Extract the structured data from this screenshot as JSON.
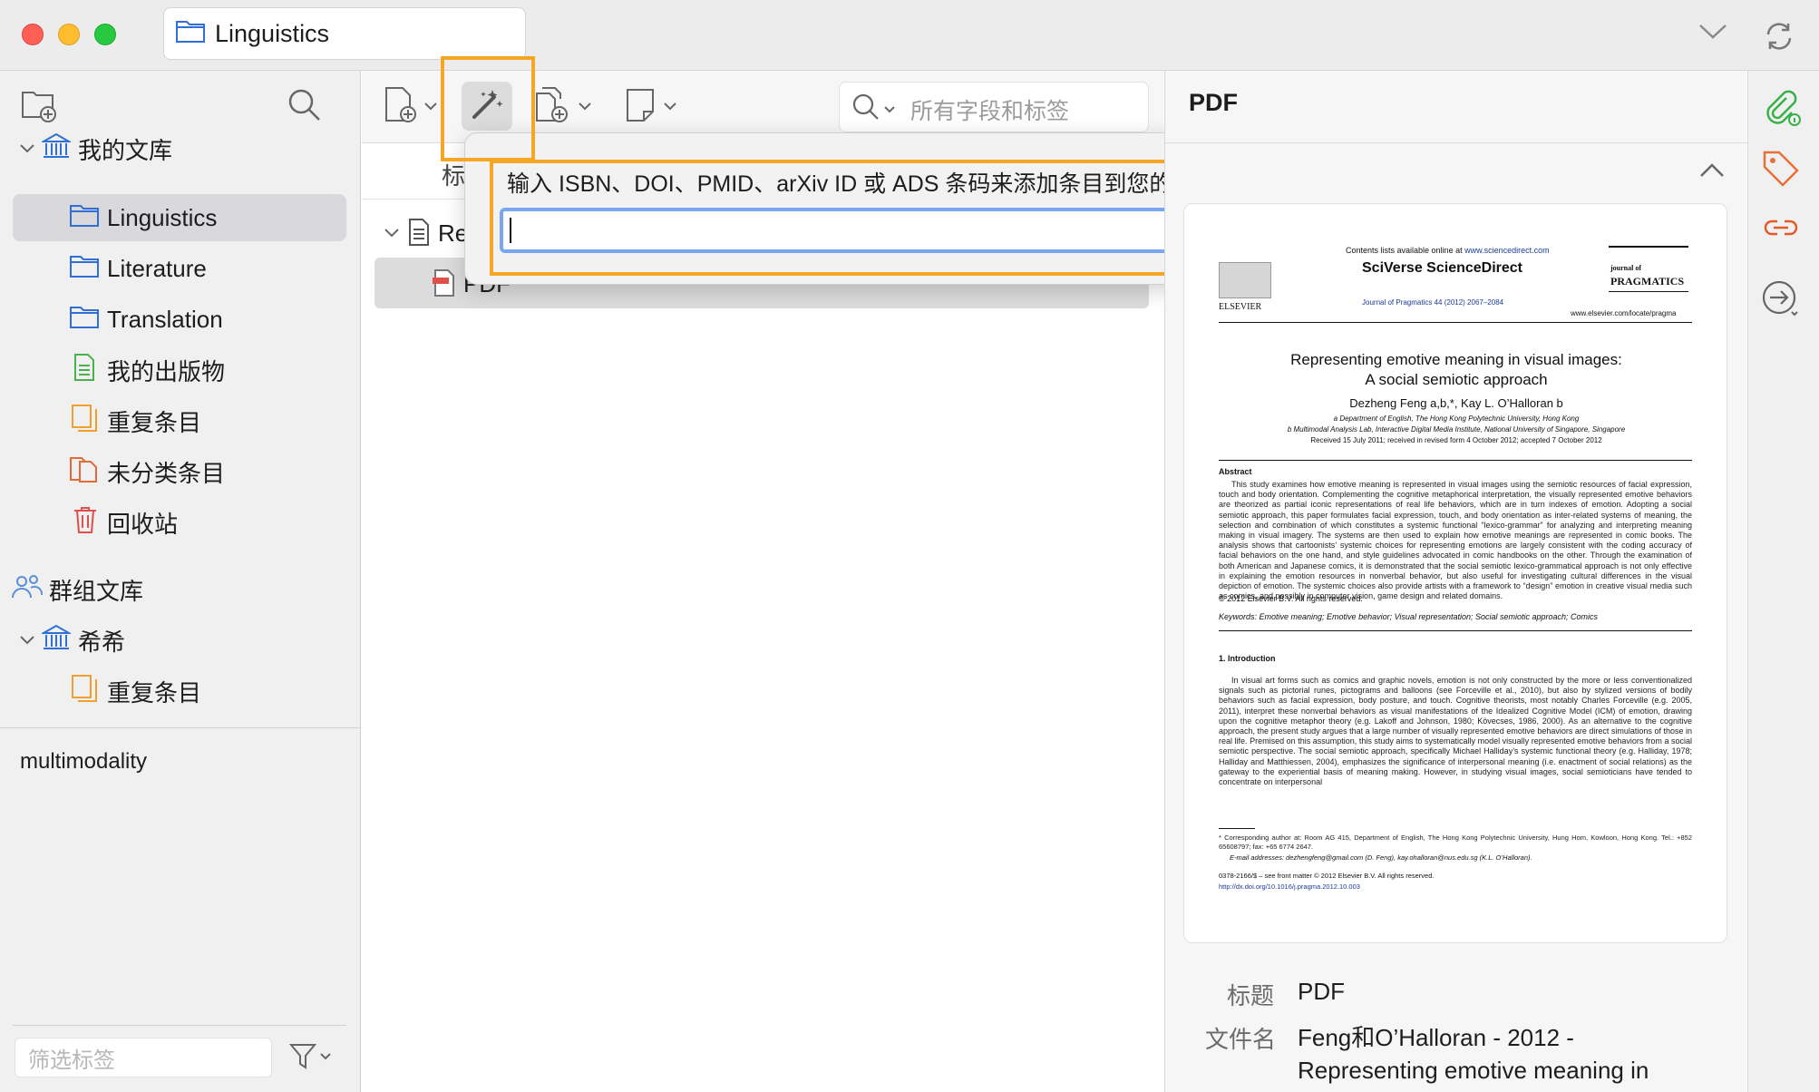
{
  "window": {
    "tab_title": "Linguistics"
  },
  "sidebar": {
    "my_library": "我的文库",
    "collections": [
      "Linguistics",
      "Literature",
      "Translation"
    ],
    "my_publications": "我的出版物",
    "duplicates": "重复条目",
    "unfiled": "未分类条目",
    "trash": "回收站",
    "group_libraries": "群组文库",
    "group_name": "希希",
    "group_duplicates": "重复条目",
    "tag": "multimodality",
    "tag_filter_placeholder": "筛选标签"
  },
  "toolbar": {
    "search_placeholder": "所有字段和标签"
  },
  "items": {
    "column_title": "标",
    "row1_title": "Re",
    "row2_title": "PDF"
  },
  "popup": {
    "prompt": "输入 ISBN、DOI、PMID、arXiv ID 或 ADS 条码来添加条目到您的文库:",
    "input_value": ""
  },
  "right_pane": {
    "header": "PDF",
    "title_label": "标题",
    "title_value": "PDF",
    "filename_label": "文件名",
    "filename_value": "Feng和O’Halloran - 2012 - Representing emotive meaning in"
  },
  "pdf_preview": {
    "available_online": "Contents lists available online at",
    "sciencedirect_url": "www.sciencedirect.com",
    "sciverse": "SciVerse ScienceDirect",
    "publisher": "ELSEVIER",
    "journal_cite": "Journal of Pragmatics 44 (2012) 2067–2084",
    "journal_logo_top": "journal of",
    "journal_logo": "PRAGMATICS",
    "journal_url": "www.elsevier.com/locate/pragma",
    "title_line1": "Representing emotive meaning in visual images:",
    "title_line2": "A social semiotic approach",
    "authors": "Dezheng Feng a,b,*, Kay L. O’Halloran b",
    "affil_a": "a Department of English, The Hong Kong Polytechnic University, Hong Kong",
    "affil_b": "b Multimodal Analysis Lab, Interactive Digital Media Institute, National University of Singapore, Singapore",
    "received": "Received 15 July 2011; received in revised form 4 October 2012; accepted 7 October 2012",
    "abstract_heading": "Abstract",
    "abstract_text": "This study examines how emotive meaning is represented in visual images using the semiotic resources of facial expression, touch and body orientation. Complementing the cognitive metaphorical interpretation, the visually represented emotive behaviors are theorized as partial iconic representations of real life behaviors, which are in turn indexes of emotion. Adopting a social semiotic approach, this paper formulates facial expression, touch, and body orientation as inter-related systems of meaning, the selection and combination of which constitutes a systemic functional “lexico-grammar” for analyzing and interpreting meaning making in visual imagery. The systems are then used to explain how emotive meanings are represented in comic books. The analysis shows that cartoonists’ systemic choices for representing emotions are largely consistent with the coding accuracy of facial behaviors on the one hand, and style guidelines advocated in comic handbooks on the other. Through the examination of both American and Japanese comics, it is demonstrated that the social semiotic lexico-grammatical approach is not only effective in explaining the emotion resources in nonverbal behavior, but also useful for investigating cultural differences in the visual depiction of emotion. The systemic choices also provide artists with a framework to “design” emotion in creative visual media such as comics, and possibly in computer vision, game design and related domains.",
    "copyright": "© 2012 Elsevier B.V. All rights reserved.",
    "keywords": "Keywords: Emotive meaning; Emotive behavior; Visual representation; Social semiotic approach; Comics",
    "intro_heading": "1. Introduction",
    "intro_text": "In visual art forms such as comics and graphic novels, emotion is not only constructed by the more or less conventionalized signals such as pictorial runes, pictograms and balloons (see Forceville et al., 2010), but also by stylized versions of bodily behaviors such as facial expression, body posture, and touch. Cognitive theorists, most notably Charles Forceville (e.g. 2005, 2011), interpret these nonverbal behaviors as visual manifestations of the Idealized Cognitive Model (ICM) of emotion, drawing upon the cognitive metaphor theory (e.g. Lakoff and Johnson, 1980; Kövecses, 1986, 2000). As an alternative to the cognitive approach, the present study argues that a large number of visually represented emotive behaviors are direct simulations of those in real life. Premised on this assumption, this study aims to systematically model visually represented emotive behaviors from a social semiotic perspective. The social semiotic approach, specifically Michael Halliday’s systemic functional theory (e.g. Halliday, 1978; Halliday and Matthiessen, 2004), emphasizes the significance of interpersonal meaning (i.e. enactment of social relations) as the gateway to the experiential basis of meaning making. However, in studying visual images, social semioticians have tended to concentrate on interpersonal",
    "footnote_1": "* Corresponding author at: Room AG 415, Department of English, The Hong Kong Polytechnic University, Hung Hom, Kowloon, Hong Kong. Tel.: +852 65608797; fax: +65 6774 2647.",
    "footnote_2": "E-mail addresses: dezhengfeng@gmail.com (D. Feng), kay.ohalloran@nus.edu.sg (K.L. O’Halloran).",
    "issn": "0378-2166/$ – see front matter © 2012 Elsevier B.V. All rights reserved.",
    "doi": "http://dx.doi.org/10.1016/j.pragma.2012.10.003"
  },
  "colors": {
    "highlight": "#f5a623",
    "input_focus": "#7aa6ef",
    "folder_blue": "#2f6fd6",
    "duplicate_orange": "#f0a030",
    "trash_red": "#e0504a",
    "publication_green": "#4caf50",
    "attach_green": "#3ab04a",
    "tag_orange": "#e8703a",
    "related_orange": "#e05a2a"
  }
}
